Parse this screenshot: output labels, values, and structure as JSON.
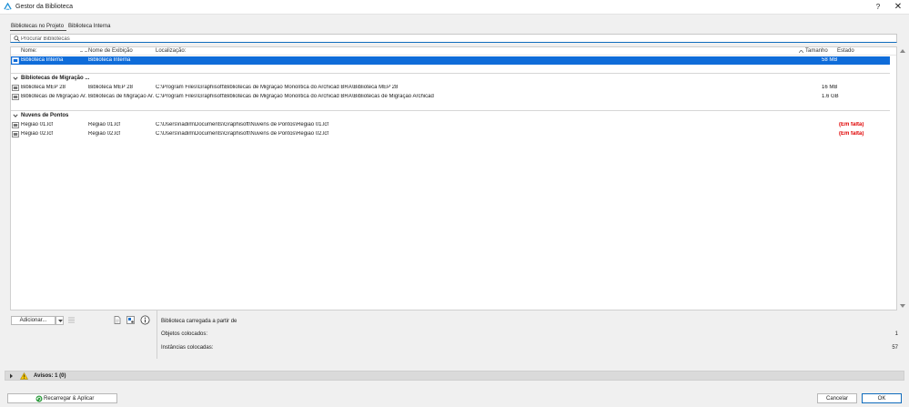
{
  "window": {
    "title": "Gestor da Biblioteca",
    "help": "?",
    "close": "✕"
  },
  "tabs": [
    {
      "label": "Bibliotecas no Projeto",
      "active": true
    },
    {
      "label": "Biblioteca Interna",
      "active": false
    }
  ],
  "search": {
    "placeholder": "Procurar Bibliotecas",
    "value": ""
  },
  "table": {
    "headers": {
      "name": "Nome:",
      "display": "Nome de Exibição",
      "location": "Localização:",
      "size": "Tamanho",
      "status": "Estado"
    },
    "selected_row": {
      "name": "Biblioteca Interna",
      "display": "Biblioteca Interna",
      "location": "",
      "size": "58 MB",
      "status": ""
    },
    "groups": [
      {
        "title": "Bibliotecas de Migração ...",
        "rows": [
          {
            "name": "Biblioteca MEP 28",
            "display": "Biblioteca MEP 28",
            "location": "C:\\Program Files\\Graphisoft\\Bibliotecas de Migração Monolítica do Archicad BRA\\Biblioteca MEP 28",
            "size": "16 MB",
            "status": ""
          },
          {
            "name": "Bibliotecas de Migração Ar...",
            "display": "Bibliotecas de Migração Ar...",
            "location": "C:\\Program Files\\Graphisoft\\Bibliotecas de Migração Monolítica do Archicad BRA\\Bibliotecas de Migração Archicad",
            "size": "1.6 GB",
            "status": ""
          }
        ]
      },
      {
        "title": "Nuvens de Pontos",
        "rows": [
          {
            "name": "Região 01.lcf",
            "display": "Região 01.lcf",
            "location": "C:\\Users\\nadim\\Documents\\Graphisoft\\Nuvens de Pontos\\Região 01.lcf",
            "size": "",
            "status": "(Em falta)"
          },
          {
            "name": "Região 02.lcf",
            "display": "Região 02.lcf",
            "location": "C:\\Users\\nadim\\Documents\\Graphisoft\\Nuvens de Pontos\\Região 02.lcf",
            "size": "",
            "status": "(Em falta)"
          }
        ]
      }
    ]
  },
  "toolbar": {
    "add_label": "Adicionar..."
  },
  "info": {
    "loaded_from": "Biblioteca carregada a partir de",
    "objects_label": "Objetos colocados:",
    "objects_value": "1",
    "instances_label": "Instâncias colocadas:",
    "instances_value": "57"
  },
  "warnings": {
    "label": "Avisos: 1 (0)"
  },
  "footer": {
    "reload_label": "Recarregar & Aplicar",
    "cancel_label": "Cancelar",
    "ok_label": "OK"
  },
  "colors": {
    "selection": "#0f6cd9",
    "missing": "#e00000",
    "accent": "#0f6cbd"
  }
}
